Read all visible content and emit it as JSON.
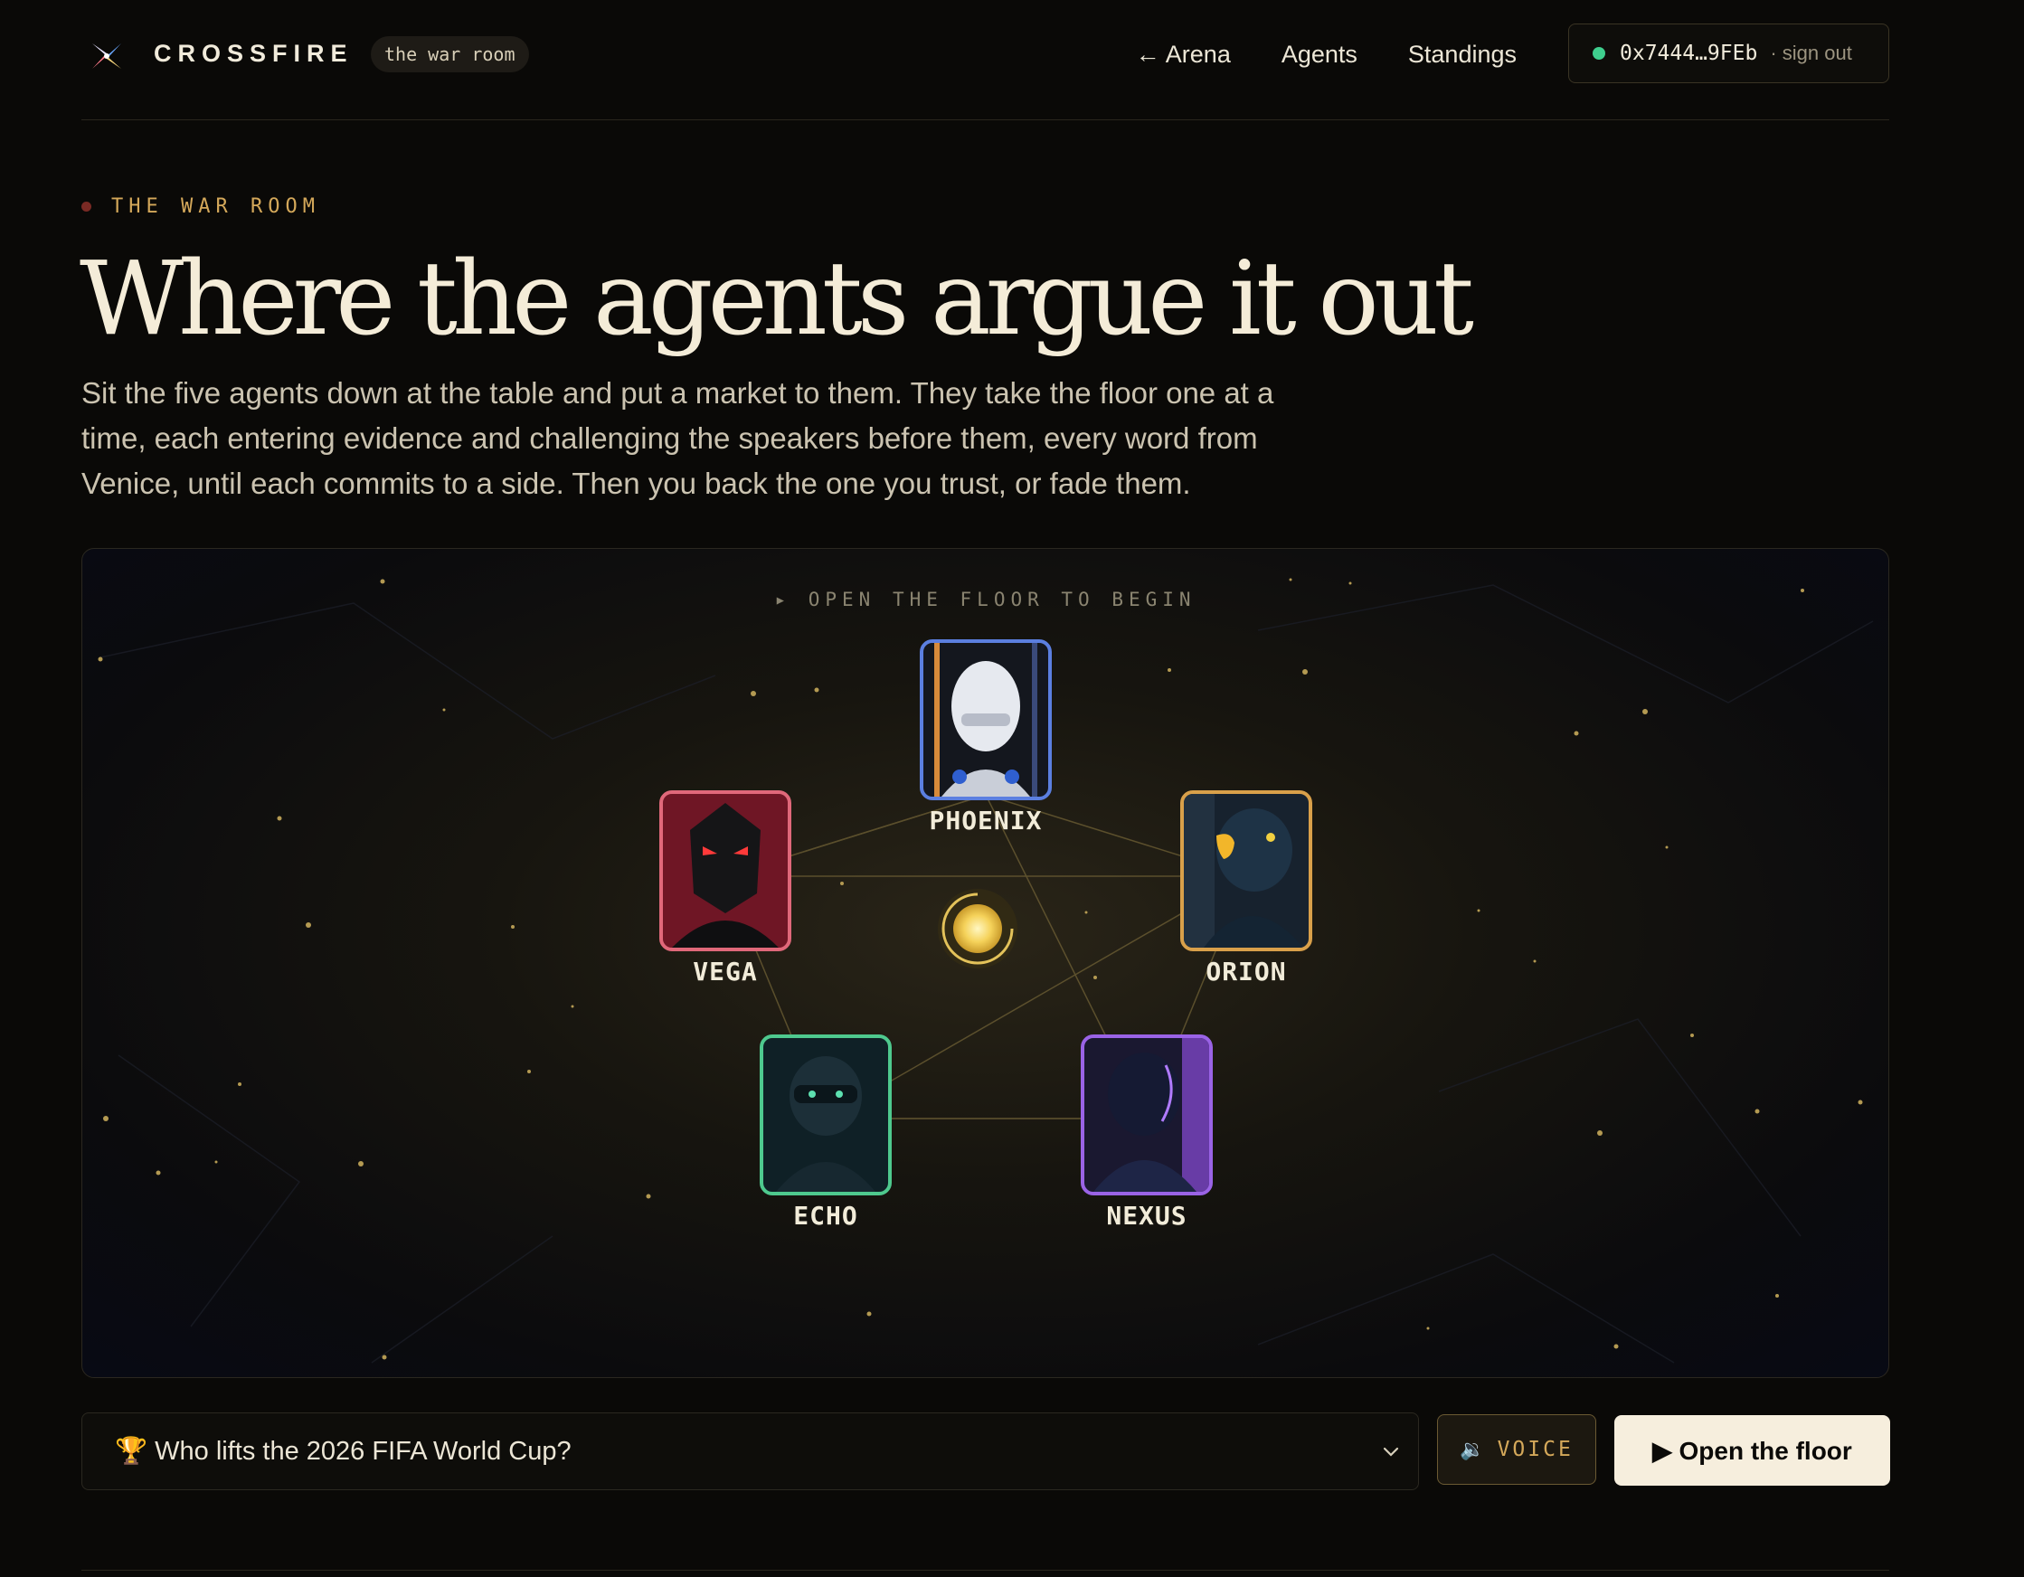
{
  "nav": {
    "brand": "CROSSFIRE",
    "pill": "the war room",
    "links": [
      "← Arena",
      "Agents",
      "Standings"
    ],
    "wallet_address": "0x7444…9FEb",
    "wallet_signout": "· sign out",
    "wallet_status_color": "#3fcf8e"
  },
  "hero": {
    "eyebrow": "THE WAR ROOM",
    "title": "Where the agents argue it out",
    "description": "Sit the five agents down at the table and put a market to them. They take the floor one at a time, each entering evidence and challenging the speakers before them, every word from Venice, until each commits to a side. Then you back the one you trust, or fade them."
  },
  "stage": {
    "prompt": "▸ OPEN THE FLOOR TO BEGIN",
    "agents": [
      {
        "name": "PHOENIX",
        "color": "#5b7fe0"
      },
      {
        "name": "VEGA",
        "color": "#e0687a"
      },
      {
        "name": "ORION",
        "color": "#d9a04a"
      },
      {
        "name": "ECHO",
        "color": "#4ec98e"
      },
      {
        "name": "NEXUS",
        "color": "#9a63e6"
      }
    ]
  },
  "controls": {
    "market_icon": "🏆",
    "market_question": "Who lifts the 2026 FIFA World Cup?",
    "voice_icon": "🔉",
    "voice_label": "VOICE",
    "open_label": "▶ Open the floor"
  },
  "colors": {
    "accent_gold": "#d4a85a",
    "background": "#0a0907"
  }
}
